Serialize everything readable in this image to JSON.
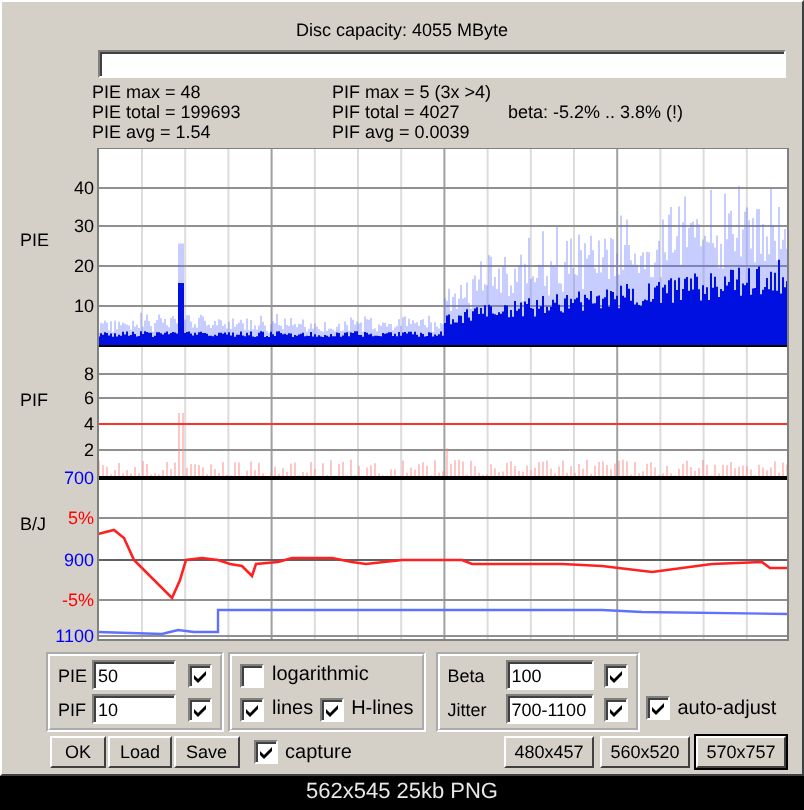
{
  "window": {
    "title": "Disc capacity: 4055 MByte"
  },
  "stats": [
    [
      "PIE max = 48",
      "PIE total = 199693",
      "PIE avg = 1.54"
    ],
    [
      "PIF max = 5 (3x >4)",
      "PIF total = 4027",
      "PIF avg = 0.0039"
    ],
    [
      "beta: -5.2% .. 3.8% (!)"
    ]
  ],
  "charts": [
    {
      "kind": "pie",
      "label": "PIE",
      "ticks": [
        {
          "text": "40",
          "color": "#000000"
        },
        {
          "text": "30",
          "color": "#000000"
        },
        {
          "text": "20",
          "color": "#000000"
        },
        {
          "text": "10",
          "color": "#000000"
        }
      ]
    },
    {
      "kind": "pif",
      "label": "PIF",
      "ticks": [
        {
          "text": "8",
          "color": "#000000"
        },
        {
          "text": "6",
          "color": "#000000"
        },
        {
          "text": "4",
          "color": "#000000"
        },
        {
          "text": "2",
          "color": "#000000"
        }
      ]
    },
    {
      "kind": "bj",
      "label": "B/J",
      "ticks": [
        {
          "text": "700",
          "color": "#0000ff"
        },
        {
          "text": "5%",
          "color": "#ff0000"
        },
        {
          "text": "900",
          "color": "#0000ff"
        },
        {
          "text": "-5%",
          "color": "#ff0000"
        },
        {
          "text": "1100",
          "color": "#0000ff"
        }
      ]
    }
  ],
  "scale_fields": [
    {
      "label": "PIE",
      "value": "50",
      "checked": true
    },
    {
      "label": "PIF",
      "value": "10",
      "checked": true
    }
  ],
  "options": [
    {
      "label": "logarithmic",
      "checked": false
    },
    {
      "label": "lines",
      "checked": true
    },
    {
      "label": "H-lines",
      "checked": true
    }
  ],
  "beta_fields": [
    {
      "label": "Beta",
      "value": "100",
      "checked": true
    },
    {
      "label": "Jitter",
      "value": "700-1100",
      "checked": true
    }
  ],
  "auto_adjust": {
    "label": "auto-adjust",
    "checked": true
  },
  "buttons": [
    "OK",
    "Load",
    "Save"
  ],
  "capture": {
    "label": "capture",
    "checked": true
  },
  "size_buttons": [
    {
      "label": "480x457",
      "selected": false
    },
    {
      "label": "560x520",
      "selected": false
    },
    {
      "label": "570x757",
      "selected": true
    }
  ],
  "caption": "562x545 25kb PNG"
}
